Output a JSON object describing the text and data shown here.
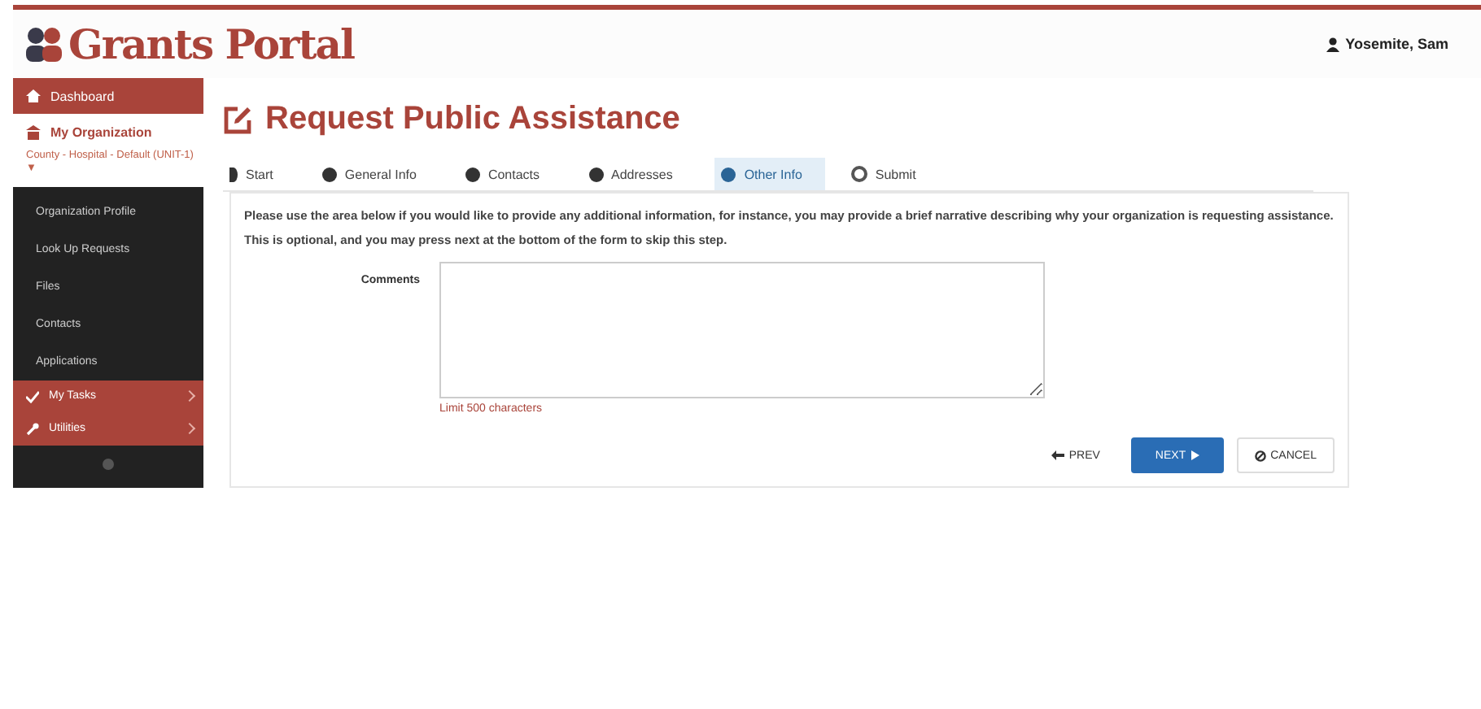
{
  "header": {
    "logo": "Grants Portal",
    "user": "Yosemite, Sam"
  },
  "sidebar": {
    "top_items": [
      {
        "label": "Dashboard",
        "selected": true
      },
      {
        "label": "My Organization",
        "selected": false
      }
    ],
    "org_subtitle": "County - Hospital - Default (UNIT-1) ▼",
    "menu": [
      {
        "label": "Organization Profile",
        "kind": "link"
      },
      {
        "label": "Look Up Requests",
        "kind": "link"
      },
      {
        "label": "Files",
        "kind": "link"
      },
      {
        "label": "Contacts",
        "kind": "link"
      },
      {
        "label": "Applications",
        "kind": "link"
      },
      {
        "label": "My Tasks",
        "kind": "section"
      },
      {
        "label": "Utilities",
        "kind": "section"
      }
    ]
  },
  "page": {
    "title": "Request Public Assistance",
    "steps": [
      {
        "label": "Start",
        "selected": false
      },
      {
        "label": "General Info",
        "selected": false
      },
      {
        "label": "Contacts",
        "selected": false
      },
      {
        "label": "Addresses",
        "selected": false
      },
      {
        "label": "Other Info",
        "selected": true
      },
      {
        "label": "Submit",
        "selected": false
      }
    ],
    "instructions": "Please use the area below if you would like to provide any additional information, for instance, you may provide a brief narrative describing why your organization is requesting assistance. This is optional, and you may press next at the bottom of the form to skip this step.",
    "comments_label": "Comments",
    "limit_note": "Limit 500 characters",
    "buttons": [
      {
        "label": "PREV",
        "kind": "prev"
      },
      {
        "label": "NEXT",
        "kind": "next"
      },
      {
        "label": "CANCEL",
        "kind": "cancel"
      }
    ]
  }
}
